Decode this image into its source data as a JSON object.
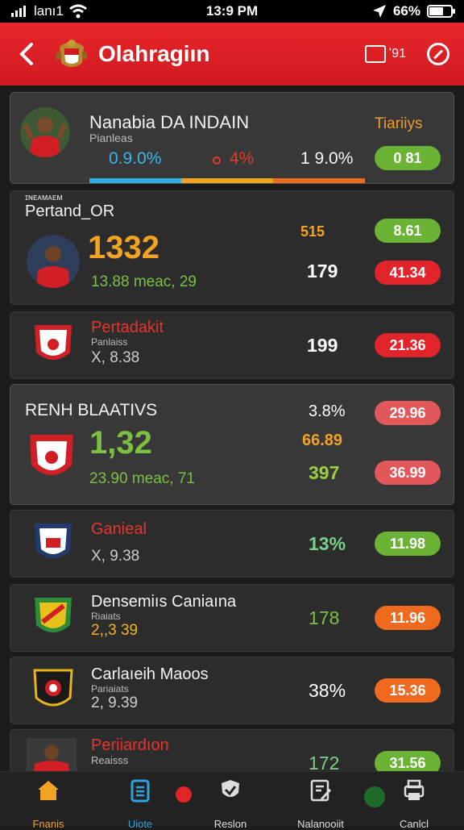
{
  "status": {
    "carrier": "lanı1",
    "time": "13:9 PM",
    "battery": "66%",
    "battery_level": 0.66
  },
  "appbar": {
    "title": "Olahragiın",
    "action_label": "ʼ91"
  },
  "cards": [
    {
      "name": "Nanabia DA INDAIN",
      "sub": "Pianleas",
      "stat1": "0.9.0%",
      "stat2": "4%",
      "stat3": "1 9.0%",
      "tag": "Tiariiys",
      "pill": "0 81"
    },
    {
      "header": "ɪɴᴇᴀᴍᴀᴇᴍ",
      "name": "Pertand_OR",
      "big": "1332",
      "subline": "13.88 meac, 29",
      "stat_small": "ᴕ15 ɡᴍ",
      "stat_small_prefix": "515",
      "stat_mid": "179",
      "pill1": "8.61",
      "pill2": "41.34"
    },
    {
      "name": "Pertadakit",
      "sub": "Panlaiss",
      "subline": "X, 8.38",
      "stat": "199",
      "pill": "21.36"
    },
    {
      "name": "RENH BLAATIVS",
      "big": "1,32",
      "subline": "23.90 meac, 71",
      "stat1": "3.8%",
      "stat2": "66.89",
      "stat3": "397",
      "pill1": "29.96",
      "pill2": "36.99"
    },
    {
      "name": "Ganieal",
      "subline": "X, 9.38",
      "stat": "13%",
      "pill": "11.98"
    },
    {
      "name": "Densemiıs Caniaına",
      "sub": "Riaiats",
      "subline": "2,,3 39",
      "stat": "178",
      "pill": "11.96"
    },
    {
      "name": "Carlaıeih Maoos",
      "sub": "Pariaiats",
      "subline": "2, 9.39",
      "stat": "38%",
      "pill": "15.36"
    },
    {
      "name": "Periiardıon",
      "sub": "Reaisss",
      "stat": "172",
      "pill": "31.56"
    }
  ],
  "tabs": [
    {
      "label": "Fnanis"
    },
    {
      "label": "Uiote"
    },
    {
      "label": "Reslon"
    },
    {
      "label": "Nalanooiit"
    },
    {
      "label": "Canlcl"
    }
  ]
}
